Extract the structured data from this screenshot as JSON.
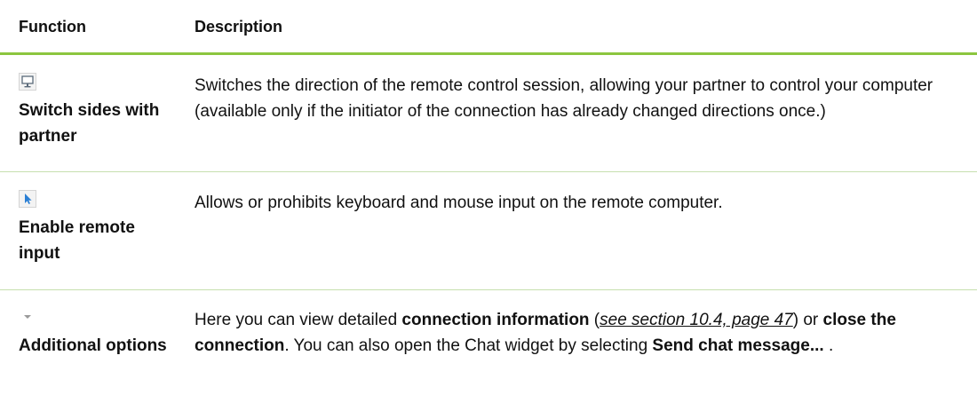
{
  "header": {
    "function_label": "Function",
    "description_label": "Description"
  },
  "rows": [
    {
      "icon": "monitor-icon",
      "function": "Switch sides with partner",
      "description": "Switches the direction of the remote control session, allowing your partner to control your computer (available only if the initiator of the connection has already changed directions once.)"
    },
    {
      "icon": "cursor-arrow-icon",
      "function": "Enable remote input",
      "description": "Allows or prohibits keyboard and mouse input on the remote computer."
    },
    {
      "icon": "dropdown-arrow-icon",
      "function": "Additional options",
      "description_parts": {
        "p1": "Here you can view detailed ",
        "b1": "connection information",
        "p2": " (",
        "ref": "see section 10.4, page 47",
        "p3": ") or ",
        "b2": "close the connection",
        "p4": ". You can also open the Chat widget by selecting ",
        "b3": "Send chat message...",
        "p5": " ."
      }
    }
  ],
  "colors": {
    "header_rule": "#8cc63f",
    "row_rule": "#c6dfae",
    "cursor_icon": "#2a7fd4"
  }
}
